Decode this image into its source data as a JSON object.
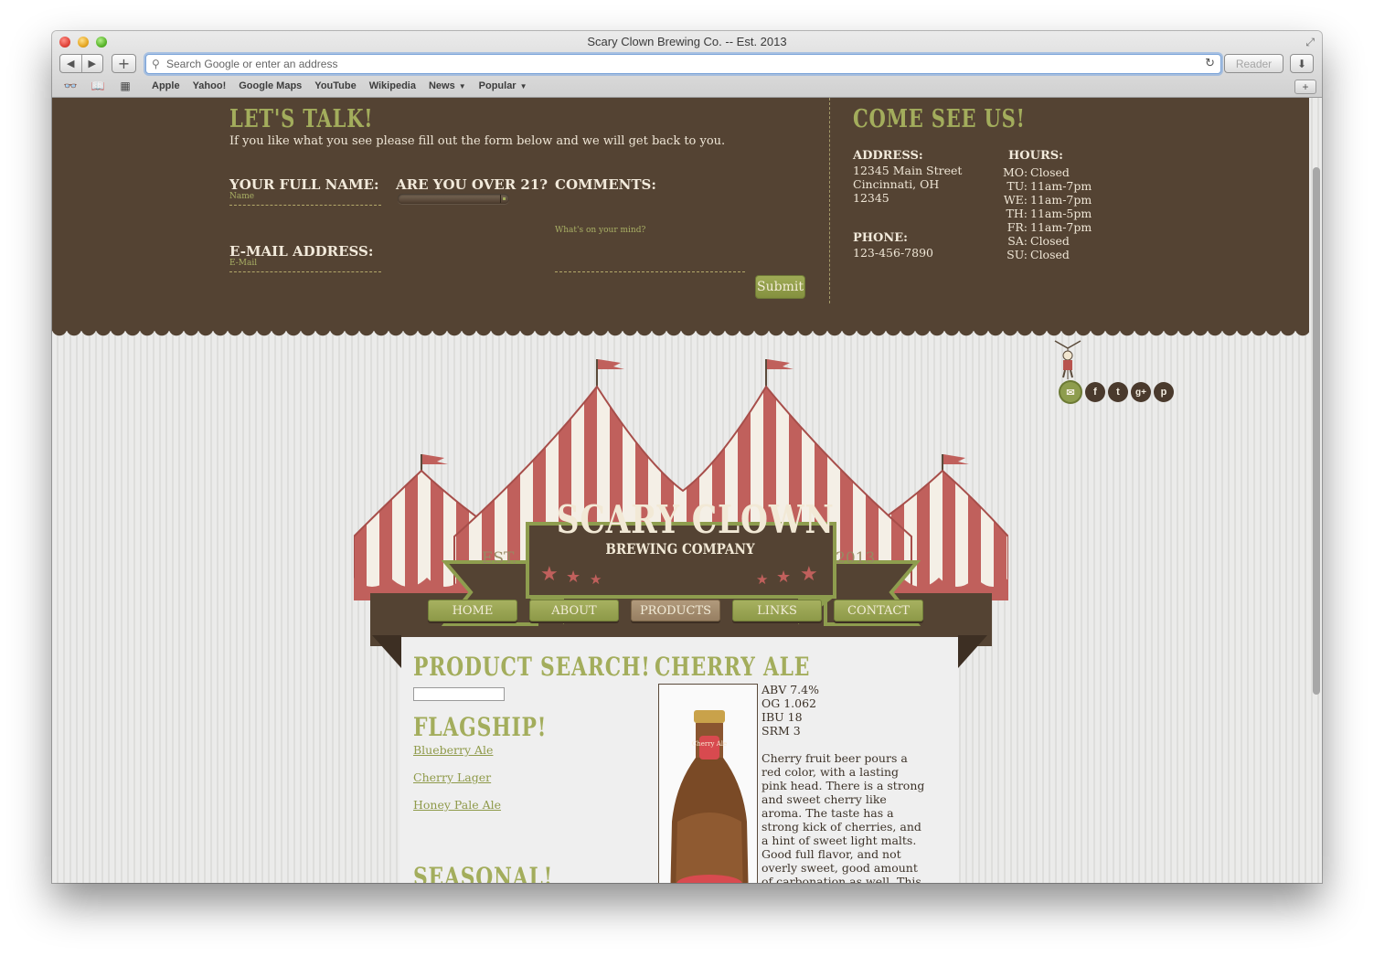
{
  "window": {
    "title": "Scary Clown Brewing Co. -- Est. 2013"
  },
  "toolbar": {
    "url_placeholder": "Search Google or enter an address",
    "reader_label": "Reader",
    "new_tab_label": "+"
  },
  "bookmarks": {
    "items": [
      {
        "label": "Apple"
      },
      {
        "label": "Yahoo!"
      },
      {
        "label": "Google Maps"
      },
      {
        "label": "YouTube"
      },
      {
        "label": "Wikipedia"
      },
      {
        "label": "News",
        "has_menu": true
      },
      {
        "label": "Popular",
        "has_menu": true
      }
    ],
    "add_label": "+"
  },
  "contact": {
    "title": "LET'S TALK!",
    "intro": "If you like what you see please fill out the form below and we will get back to you.",
    "name_label": "YOUR FULL NAME:",
    "name_placeholder": "Name",
    "age_label": "ARE YOU OVER 21?",
    "comments_label": "COMMENTS:",
    "comments_placeholder": "What's on your mind?",
    "email_label": "E-MAIL ADDRESS:",
    "email_placeholder": "E-Mail",
    "submit_label": "Submit"
  },
  "visit": {
    "title": "COME SEE US!",
    "address_label": "ADDRESS:",
    "address_lines": [
      "12345 Main Street",
      "Cincinnati, OH",
      "12345"
    ],
    "phone_label": "PHONE:",
    "phone": "123-456-7890",
    "hours_label": "HOURS:",
    "hours": [
      {
        "day": "MO:",
        "time": "Closed"
      },
      {
        "day": "TU:",
        "time": "11am-7pm"
      },
      {
        "day": "WE:",
        "time": "11am-7pm"
      },
      {
        "day": "TH:",
        "time": "11am-5pm"
      },
      {
        "day": "FR:",
        "time": "11am-7pm"
      },
      {
        "day": "SA:",
        "time": "Closed"
      },
      {
        "day": "SU:",
        "time": "Closed"
      }
    ]
  },
  "social": [
    "mail-icon",
    "facebook-icon",
    "twitter-icon",
    "google-plus-icon",
    "pinterest-icon"
  ],
  "logo": {
    "title": "SCARY CLOWN",
    "subtitle": "BREWING COMPANY",
    "est": "EST.",
    "year": "2013"
  },
  "nav": {
    "items": [
      {
        "label": "HOME"
      },
      {
        "label": "ABOUT"
      },
      {
        "label": "PRODUCTS",
        "active": true
      },
      {
        "label": "LINKS"
      },
      {
        "label": "CONTACT"
      }
    ]
  },
  "products": {
    "search_title": "PRODUCT SEARCH!",
    "flagship_title": "FLAGSHIP!",
    "flagship_items": [
      "Blueberry Ale",
      "Cherry Lager",
      "Honey Pale Ale"
    ],
    "seasonal_title": "SEASONAL!"
  },
  "featured": {
    "title": "CHERRY ALE",
    "stats": [
      "ABV 7.4%",
      "OG 1.062",
      "IBU 18",
      "SRM 3"
    ],
    "description": "Cherry fruit beer pours a red color, with a lasting pink head. There is a strong and sweet cherry like aroma. The taste has a strong kick of cherries, and a hint of sweet light malts. Good full flavor, and not overly sweet, good amount of carbonation as well. This is the cherry lover's",
    "bottle_label": "Cherry Ale"
  },
  "colors": {
    "brown": "#544333",
    "olive": "#a3ad5c",
    "tent_red": "#c0605c",
    "cream": "#f2e9d6"
  }
}
